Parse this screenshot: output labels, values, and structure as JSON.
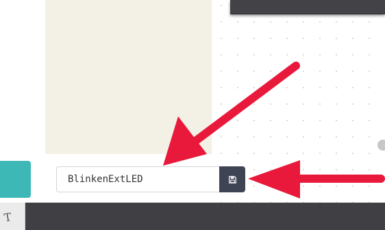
{
  "project": {
    "name_value": "BlinkenExtLED"
  },
  "icons": {
    "save": "floppy-disk-icon",
    "bottom_tab": "text-tool-icon"
  },
  "bottom_bar": {
    "tab_glyph": "T"
  },
  "colors": {
    "accent_teal": "#3eb8b6",
    "save_button": "#3e4453",
    "annotation_arrow": "#e8193a",
    "toolbox_bg": "#f3f1e6",
    "dark_bar": "#3f3f44"
  }
}
